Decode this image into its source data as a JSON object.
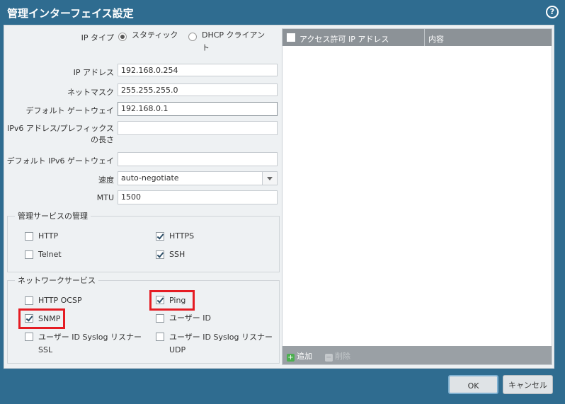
{
  "title": "管理インターフェイス設定",
  "ip_type": {
    "label": "IP タイプ",
    "options": [
      "スタティック",
      "DHCP クライアント"
    ],
    "selected": "スタティック"
  },
  "fields": {
    "ip_address": {
      "label": "IP アドレス",
      "value": "192.168.0.254"
    },
    "netmask": {
      "label": "ネットマスク",
      "value": "255.255.255.0"
    },
    "gateway": {
      "label": "デフォルト ゲートウェイ",
      "value": "192.168.0.1"
    },
    "ipv6_address": {
      "label": "IPv6 アドレス/プレフィックスの長さ",
      "value": ""
    },
    "ipv6_gateway": {
      "label": "デフォルト IPv6 ゲートウェイ",
      "value": ""
    },
    "speed": {
      "label": "速度",
      "value": "auto-negotiate"
    },
    "mtu": {
      "label": "MTU",
      "value": "1500"
    }
  },
  "mgmt_services": {
    "legend": "管理サービスの管理",
    "items": [
      {
        "label": "HTTP",
        "checked": false
      },
      {
        "label": "HTTPS",
        "checked": true
      },
      {
        "label": "Telnet",
        "checked": false
      },
      {
        "label": "SSH",
        "checked": true
      }
    ]
  },
  "network_services": {
    "legend": "ネットワークサービス",
    "items": [
      {
        "label": "HTTP OCSP",
        "checked": false
      },
      {
        "label": "Ping",
        "checked": true
      },
      {
        "label": "SNMP",
        "checked": true
      },
      {
        "label": "ユーザー ID",
        "checked": false
      },
      {
        "label": "ユーザー ID Syslog リスナー SSL",
        "checked": false
      },
      {
        "label": "ユーザー ID Syslog リスナー UDP",
        "checked": false
      }
    ]
  },
  "permitted_ip": {
    "col1": "アクセス許可 IP アドレス",
    "col2": "内容",
    "add_label": "追加",
    "delete_label": "削除"
  },
  "buttons": {
    "ok": "OK",
    "cancel": "キャンセル"
  },
  "colors": {
    "title_bar": "#2f6c90",
    "highlight": "#e51c23",
    "grid_header": "#8c9297"
  }
}
